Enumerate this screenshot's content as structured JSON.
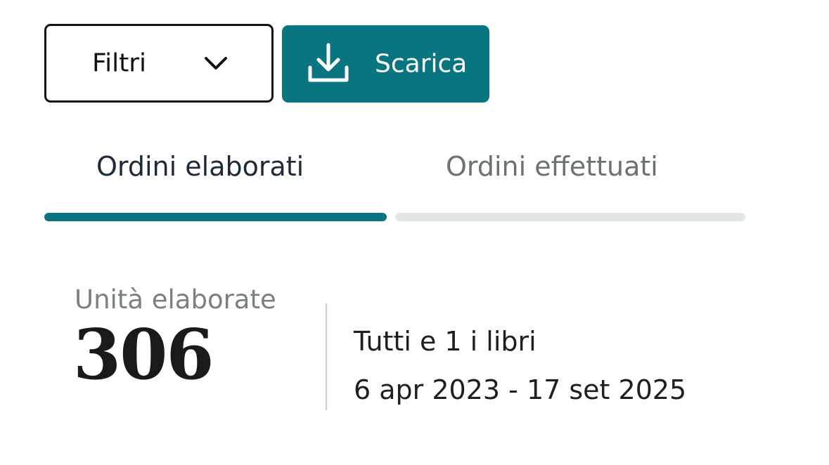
{
  "toolbar": {
    "filter_label": "Filtri",
    "download_label": "Scarica"
  },
  "tabs": [
    {
      "label": "Ordini elaborati",
      "active": true
    },
    {
      "label": "Ordini effettuati",
      "active": false
    }
  ],
  "summary": {
    "units_label": "Unità elaborate",
    "units_value": "306",
    "books_text": "Tutti e 1 i libri",
    "date_range": "6 apr 2023 - 17 set 2025"
  },
  "colors": {
    "accent": "#087581",
    "inactive_bar": "#e3e6e6",
    "active_tab_text": "#1e2a3a",
    "inactive_tab_text": "#6a7173"
  },
  "icons": {
    "filter": "chevron-down-icon",
    "download": "download-icon"
  }
}
